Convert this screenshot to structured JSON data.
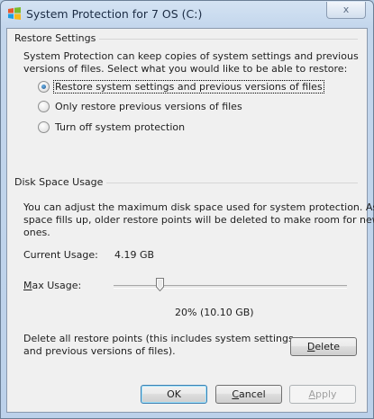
{
  "window": {
    "title": "System Protection for 7 OS (C:)",
    "close_glyph": "x"
  },
  "restore": {
    "group_title": "Restore Settings",
    "description_lines": [
      "System Protection can keep copies of system settings and previous",
      "versions of files. Select what you would like to be able to restore:"
    ],
    "options": [
      {
        "label": "Restore system settings and previous versions of files",
        "selected": true
      },
      {
        "label": "Only restore previous versions of files",
        "selected": false
      },
      {
        "label": "Turn off system protection",
        "selected": false
      }
    ]
  },
  "disk": {
    "group_title": "Disk Space Usage",
    "description_lines": [
      "You can adjust the maximum disk space used for system protection. As",
      "space fills up, older restore points will be deleted to make room for new",
      "ones."
    ],
    "current_usage_label": "Current Usage:",
    "current_usage_value": "4.19 GB",
    "max_usage_label_accel": "M",
    "max_usage_label_rest": "ax Usage:",
    "max_usage_percent": 20,
    "max_usage_text": "20% (10.10 GB)",
    "delete_text_lines": [
      "Delete all restore points (this includes system settings",
      "and previous versions of files)."
    ],
    "delete_button_accel": "D",
    "delete_button_rest": "elete"
  },
  "buttons": {
    "ok": "OK",
    "cancel_accel": "C",
    "cancel_rest": "ancel",
    "apply_accel": "A",
    "apply_rest": "pply"
  },
  "colors": {
    "accent": "#3c7fb1",
    "window_frame": "#c3d6ec",
    "dialog_bg": "#f0f0f0"
  }
}
